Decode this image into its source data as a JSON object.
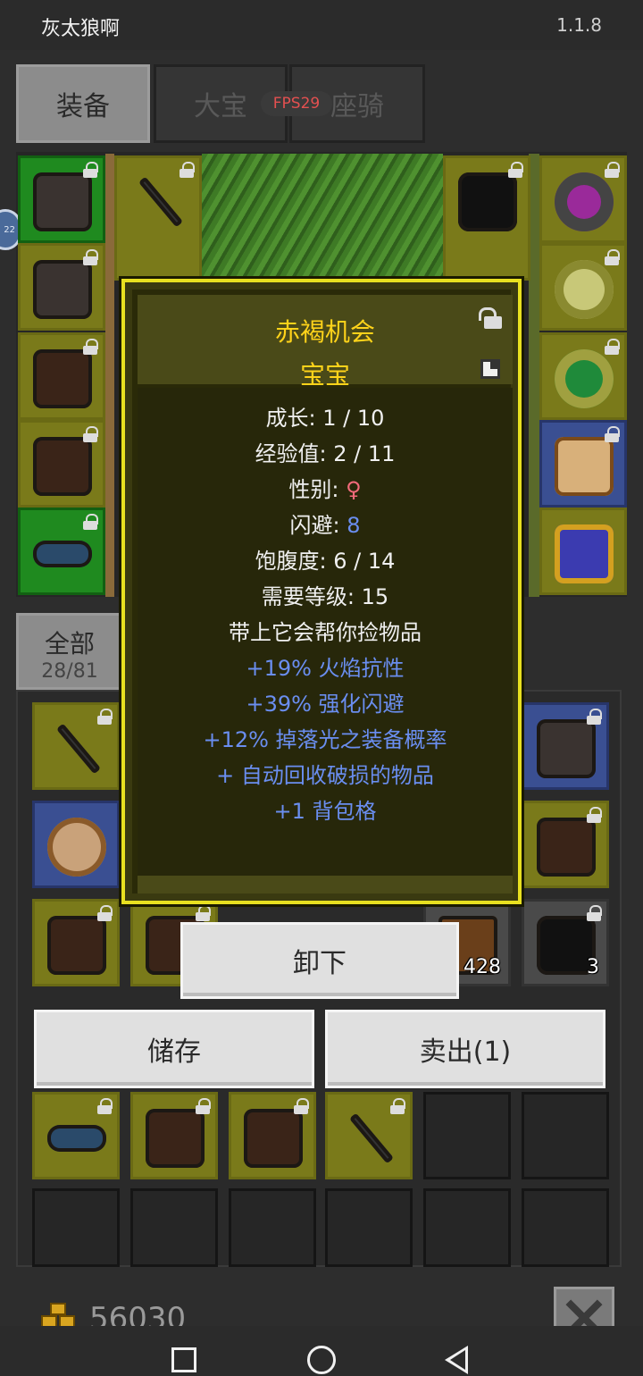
{
  "app": {
    "title": "灰太狼啊",
    "version": "1.1.8"
  },
  "tabs": {
    "equip": "装备",
    "pet": "大宝",
    "mount": "座骑",
    "fps": "FPS29"
  },
  "filter": {
    "label": "全部",
    "count": "28/81"
  },
  "tooltip": {
    "name": "赤褐机会",
    "subtitle": "宝宝",
    "growth": "成长: 1 / 10",
    "exp": "经验值: 2 / 11",
    "gender_label": "性别: ",
    "gender_symbol": "♀",
    "dodge_label": "闪避: ",
    "dodge_value": "8",
    "satiety": "饱腹度: 6 / 14",
    "level_req": "需要等级: 15",
    "desc": "带上它会帮你捡物品",
    "bonuses": [
      "+19% 火焰抗性",
      "+39% 强化闪避",
      "+12% 掉落光之装备概率",
      "+ 自动回收破损的物品",
      "+1 背包格"
    ]
  },
  "buttons": {
    "unequip": "卸下",
    "store": "储存",
    "sell": "卖出(1)"
  },
  "inventory": {
    "bag_count": "428",
    "ore_count": "3"
  },
  "gold": "56030",
  "side_badge": "22",
  "colors": {
    "tooltip_title": "#ffd31a",
    "bonus_blue": "#6a8ef0",
    "female_pink": "#f26a7a",
    "tooltip_border": "#e8e020"
  }
}
